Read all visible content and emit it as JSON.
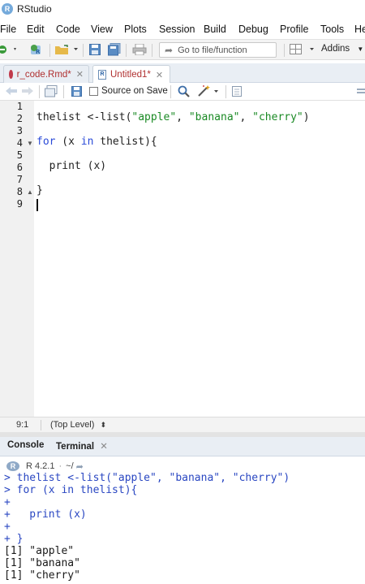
{
  "window": {
    "title": "RStudio"
  },
  "menu": [
    "File",
    "Edit",
    "Code",
    "View",
    "Plots",
    "Session",
    "Build",
    "Debug",
    "Profile",
    "Tools",
    "He"
  ],
  "toolbar": {
    "goto_placeholder": "Go to file/function",
    "addins_label": "Addins"
  },
  "editor_tabs": [
    {
      "label": "r_code.Rmd*",
      "active": false
    },
    {
      "label": "Untitled1*",
      "active": true
    }
  ],
  "editor_toolbar": {
    "source_on_save_label": "Source on Save",
    "source_on_save_checked": false
  },
  "editor": {
    "line_numbers": [
      "1",
      "2",
      "3",
      "4",
      "5",
      "6",
      "7",
      "8",
      "9"
    ],
    "lines": {
      "l2_a": "thelist <-list(",
      "l2_s1": "\"apple\"",
      "l2_c1": ", ",
      "l2_s2": "\"banana\"",
      "l2_c2": ", ",
      "l2_s3": "\"cherry\"",
      "l2_end": ")",
      "l4_kw_for": "for",
      "l4_a": " (x ",
      "l4_kw_in": "in",
      "l4_b": " thelist){",
      "l6": "  print (x)",
      "l8": "}"
    }
  },
  "status": {
    "position": "9:1",
    "scope": "(Top Level)"
  },
  "console_tabs": [
    {
      "label": "Console",
      "active": true
    },
    {
      "label": "Terminal",
      "active": false
    }
  ],
  "console": {
    "r_version": "R 4.2.1",
    "wd": "~/",
    "lines": [
      {
        "text": "> thelist <-list(\"apple\", \"banana\", \"cherry\")",
        "kind": "in"
      },
      {
        "text": "> for (x in thelist){",
        "kind": "in"
      },
      {
        "text": "+",
        "kind": "in"
      },
      {
        "text": "+   print (x)",
        "kind": "in"
      },
      {
        "text": "+",
        "kind": "in"
      },
      {
        "text": "+ }",
        "kind": "in"
      },
      {
        "text": "[1] \"apple\"",
        "kind": "out"
      },
      {
        "text": "[1] \"banana\"",
        "kind": "out"
      },
      {
        "text": "[1] \"cherry\"",
        "kind": "out"
      }
    ]
  },
  "colors": {
    "keyword": "#2a4ad8",
    "string": "#1a8a24",
    "console_input": "#2a47c2",
    "tab_text": "#b03030"
  }
}
